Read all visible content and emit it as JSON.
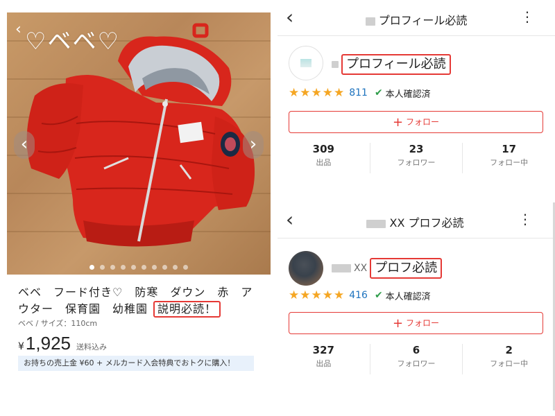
{
  "item": {
    "photo_caption": "♡ベベ♡",
    "photo_icons": [
      "back-chevron-icon",
      "prev-arrow-icon",
      "next-arrow-icon"
    ],
    "carousel_total": 10,
    "carousel_active": 0,
    "title_text": "ベベ　フード付き♡　防寒　ダウン　赤　アウター　保育園　幼稚園",
    "title_highlight": "説明必読！",
    "meta": "ベベ / サイズ：110cm",
    "price_currency": "¥",
    "price_amount": "1,925",
    "shipping": "送料込み",
    "promo": "お持ちの売上金 ¥60 + メルカード入会特典でおトクに購入！"
  },
  "profile1": {
    "title": "プロフィール必読",
    "name": "プロフィール必読",
    "stars": "★★★★★",
    "rating_count": "811",
    "verify_label": "本人確認済",
    "follow_label": "フォロー",
    "stats": [
      {
        "num": "309",
        "label": "出品"
      },
      {
        "num": "23",
        "label": "フォロワー"
      },
      {
        "num": "17",
        "label": "フォロー中"
      }
    ]
  },
  "profile2": {
    "title_prefix": "XX",
    "title": "プロフ必読",
    "name_prefix": "XX",
    "name": "プロフ必読",
    "stars": "★★★★★",
    "rating_count": "416",
    "verify_label": "本人確認済",
    "follow_label": "フォロー",
    "stats": [
      {
        "num": "327",
        "label": "出品"
      },
      {
        "num": "6",
        "label": "フォロワー"
      },
      {
        "num": "2",
        "label": "フォロー中"
      }
    ]
  },
  "colors": {
    "accent_red": "#e53935",
    "star": "#f5a623",
    "count_blue": "#1e73be",
    "verify_green": "#2e9d4a",
    "jacket_red": "#d8261c"
  }
}
